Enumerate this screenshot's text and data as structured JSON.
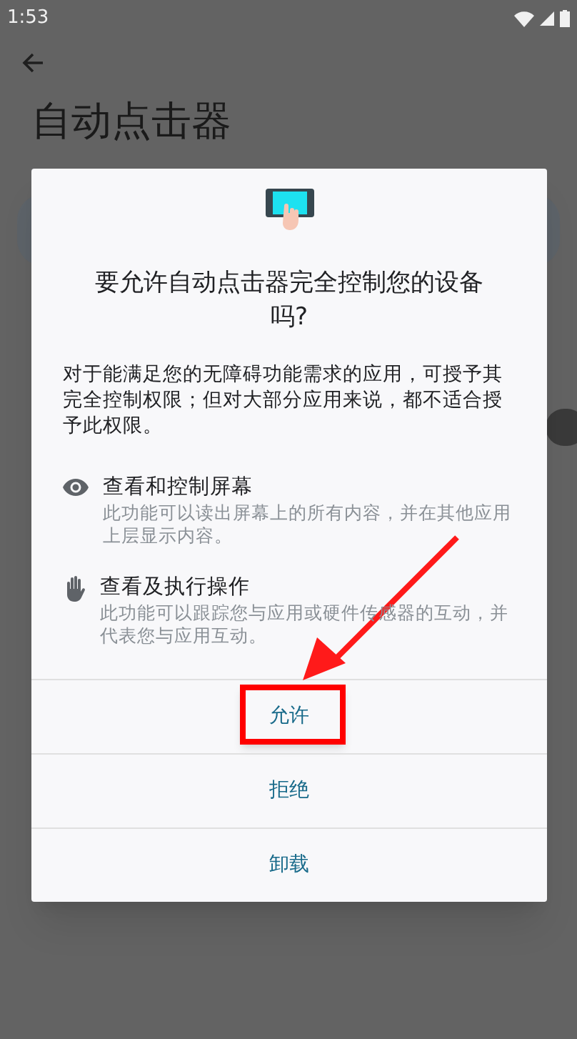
{
  "status_bar": {
    "time": "1:53"
  },
  "page": {
    "title": "自动点击器"
  },
  "dialog": {
    "title": "要允许自动点击器完全控制您的设备吗?",
    "message": "对于能满足您的无障碍功能需求的应用，可授予其完全控制权限；但对大部分应用来说，都不适合授予此权限。",
    "permissions": [
      {
        "kind": "eye",
        "title": "查看和控制屏幕",
        "description": "此功能可以读出屏幕上的所有内容，并在其他应用上层显示内容。"
      },
      {
        "kind": "hand",
        "title": "查看及执行操作",
        "description": "此功能可以跟踪您与应用或硬件传感器的互动，并代表您与应用互动。"
      }
    ],
    "buttons": [
      {
        "label": "允许",
        "highlighted": true
      },
      {
        "label": "拒绝",
        "highlighted": false
      },
      {
        "label": "卸载",
        "highlighted": false
      }
    ]
  }
}
